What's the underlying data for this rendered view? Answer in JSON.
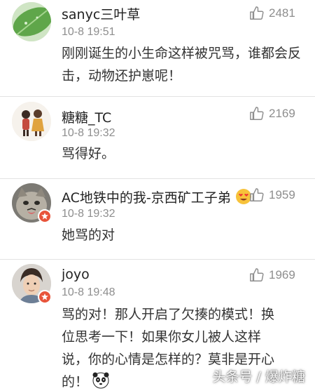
{
  "comments": [
    {
      "username": "sanyc三叶草",
      "time": "10-8 19:51",
      "likes": "2481",
      "text": "刚刚诞生的小生命这样被咒骂，谁都会反击，动物还护崽呢！",
      "verified": false,
      "avatar": "leaf-photo"
    },
    {
      "username": "糖糖_TC",
      "time": "10-8 19:32",
      "likes": "2169",
      "text": "骂得好。",
      "verified": false,
      "avatar": "illustrated-figures"
    },
    {
      "username": "AC地铁中的我-京西矿工子弟",
      "time": "10-8 19:32",
      "likes": "1959",
      "text": "她骂的对",
      "verified": true,
      "avatar": "cat-photo",
      "name_emoji": "love-eyes-emoji"
    },
    {
      "username": "joyo",
      "time": "10-8 19:48",
      "likes": "1969",
      "text_lines": [
        "骂的对！那人开启了欠揍的模式！换",
        "位思考一下！如果你女儿被人这样",
        "说，你的心情是怎样的？莫非是开心",
        "的！"
      ],
      "verified": true,
      "avatar": "person-photo",
      "trailing_emoji": "panda-emoji"
    }
  ],
  "watermark": "头条号 / 爆炸糖",
  "colors": {
    "like_gray": "#8e8e8e",
    "badge_red": "#e8543b",
    "divider": "#e3e3e3"
  }
}
